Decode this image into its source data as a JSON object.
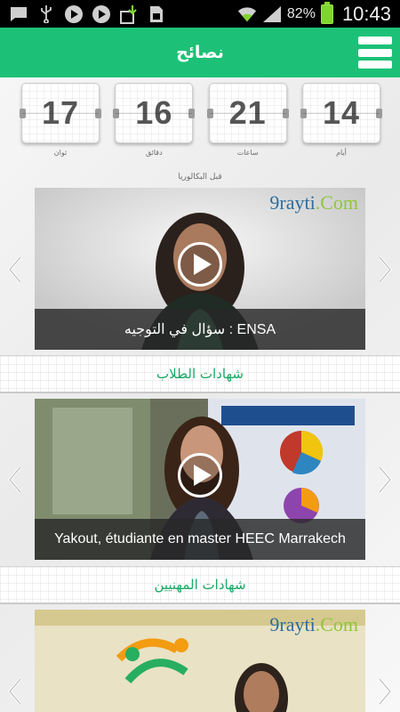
{
  "status_bar": {
    "battery": "82%",
    "time": "10:43",
    "icons": [
      "message-icon",
      "usb-icon",
      "play-icon",
      "play-icon",
      "download-icon",
      "sim-icon",
      "wifi-icon",
      "signal-icon",
      "battery-icon"
    ]
  },
  "header": {
    "title": "نصائح",
    "menu_icon": "hamburger-menu-icon"
  },
  "countdown": {
    "units": [
      {
        "value": "14",
        "label": "أيام"
      },
      {
        "value": "21",
        "label": "ساعات"
      },
      {
        "value": "16",
        "label": "دقائق"
      },
      {
        "value": "17",
        "label": "ثوان"
      }
    ],
    "caption": "قبل البكالوريا"
  },
  "videos": [
    {
      "caption": "سؤال في التوجيه : ENSA",
      "logo": "9rayti.Com"
    },
    {
      "caption": "Yakout, étudiante en master HEEC Marrakech",
      "logo": ""
    },
    {
      "caption": "",
      "logo": "9rayti.Com"
    }
  ],
  "sections": [
    {
      "title": "شهادات الطلاب"
    },
    {
      "title": "شهادات المهنيين"
    }
  ],
  "colors": {
    "accent": "#1cc177",
    "section_text": "#1aa866",
    "status_bar": "#000000"
  }
}
